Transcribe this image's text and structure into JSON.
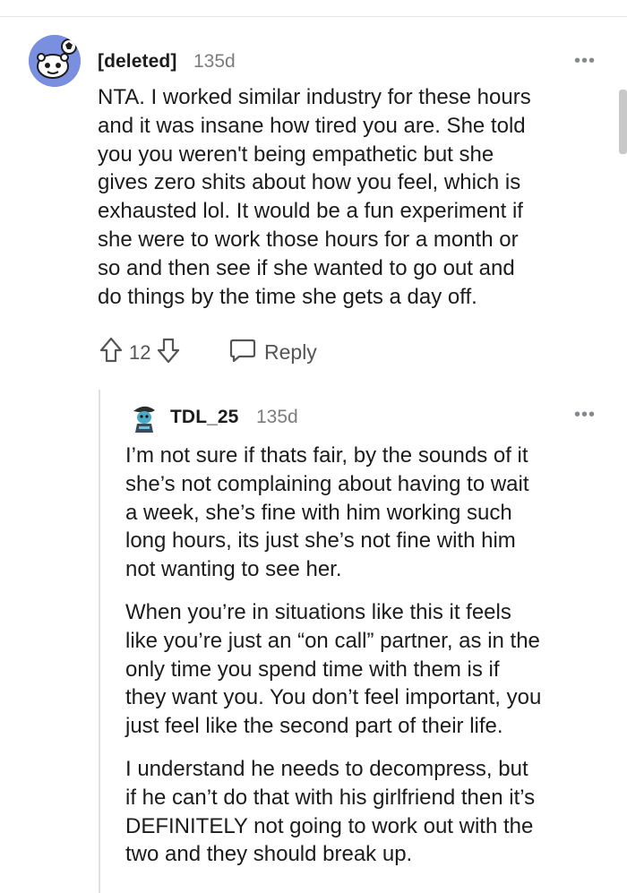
{
  "parent_comment": {
    "author": "[deleted]",
    "age": "135d",
    "more_label": "•••",
    "avatar_icon": "reddit-snoo-avatar-icon",
    "lines": [
      "NTA. I worked similar industry for these hours",
      "and it was insane how tired you are. She told",
      "you you weren't being empathetic but she",
      "gives zero shits about how you feel, which is",
      "exhausted lol. It would be a fun experiment if",
      "she were to work those hours for a month or",
      "so and then see if she wanted to go out and",
      "do things by the time she gets a day off."
    ],
    "vote_count": "12",
    "reply_label": "Reply"
  },
  "child_comment": {
    "author": "TDL_25",
    "age": "135d",
    "more_label": "•••",
    "avatar_icon": "user-avatar-icon",
    "paragraphs": [
      [
        "I’m not sure if thats fair, by the sounds of it",
        "she’s not complaining about having to wait",
        "a week, she’s fine with him working such",
        "long hours, its just she’s not fine with him",
        "not wanting to see her."
      ],
      [
        "When you’re in situations like this it feels",
        "like you’re just an “on call” partner, as in the",
        "only time you spend time with them is if",
        "they want you. You don’t feel important, you",
        "just feel like the second part of their life."
      ],
      [
        "I understand he needs to decompress, but",
        "if he can’t do that with his girlfriend then it’s",
        "DEFINITELY not going to work out with the",
        "two and they should break up."
      ]
    ]
  },
  "colors": {
    "text": "#1c1c1c",
    "meta": "#7c7c7c",
    "avatar_bg": "#7b8fe0",
    "divider": "#e6e6e6"
  }
}
